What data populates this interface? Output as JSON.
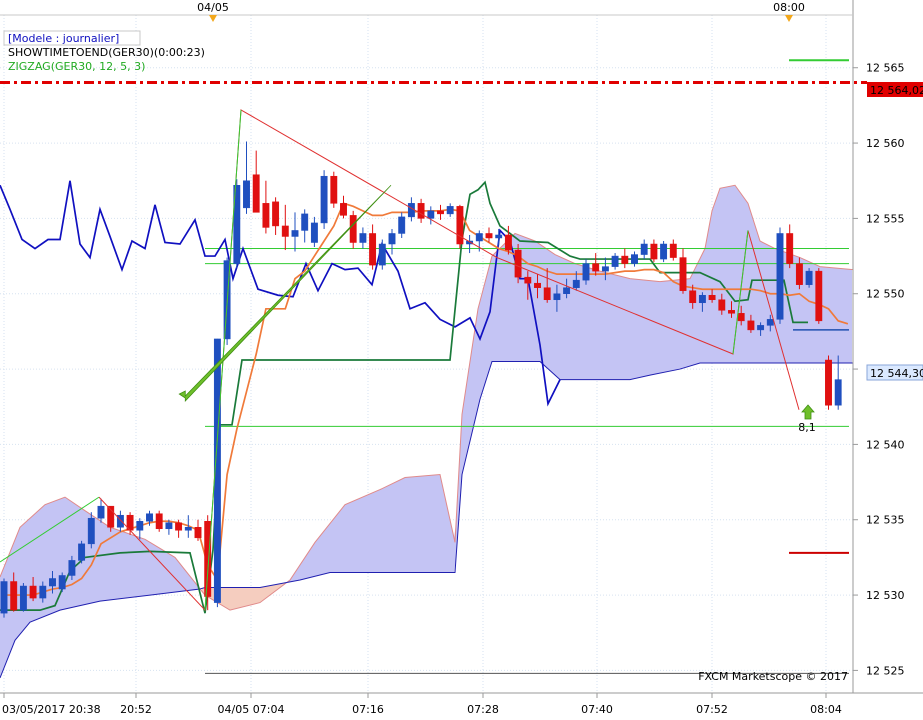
{
  "chart_data": {
    "type": "candlestick",
    "legend": {
      "model": "[Modele : journalier]",
      "indicator1": "SHOWTIMETOEND(GER30)(0:00:23)",
      "indicator2": "ZIGZAG(GER30, 12, 5, 3)"
    },
    "watermark": "FXCM Marketscope © 2017",
    "top_markers": [
      "04/05",
      "08:00"
    ],
    "x_tick_labels": [
      "03/05/2017 20:38",
      "20:52",
      "04/05 07:04",
      "07:16",
      "07:28",
      "07:40",
      "07:52",
      "08:04"
    ],
    "y_tick_labels": [
      "12 525",
      "12 530",
      "12 535",
      "12 540",
      "12 545",
      "12 550",
      "12 555",
      "12 560",
      "12 565"
    ],
    "ylim": [
      12523.5,
      12568.5
    ],
    "price_labels": {
      "red_level": "12 564,02",
      "current": "12 544,30"
    },
    "annotation": "8,1",
    "colors": {
      "bull": "#1f4fbf",
      "bear": "#e01010",
      "cloud_blue": "#c4c4f4",
      "cloud_pink": "#f5cdbf",
      "tenkan": "#f07a3a",
      "kijun": "#1a7a3a",
      "chikou": "#1010c0",
      "zigzag_red": "#e03030",
      "zigzag_green": "#33cc33",
      "level_line": "#33cc33",
      "red_dash": "#e00000"
    },
    "candles": [
      [
        12528.8,
        12531.1,
        12528.5,
        12530.9
      ],
      [
        12530.9,
        12531.5,
        12528.9,
        12529.0
      ],
      [
        12529.0,
        12530.8,
        12528.9,
        12530.6
      ],
      [
        12530.6,
        12531.2,
        12529.6,
        12529.8
      ],
      [
        12529.8,
        12530.9,
        12529.5,
        12530.6
      ],
      [
        12530.6,
        12531.6,
        12530.1,
        12531.1
      ],
      [
        12530.4,
        12531.5,
        12530.2,
        12531.3
      ],
      [
        12531.3,
        12532.6,
        12531.0,
        12532.3
      ],
      [
        12532.3,
        12533.6,
        12532.1,
        12533.4
      ],
      [
        12533.4,
        12535.5,
        12533.1,
        12535.1
      ],
      [
        12535.1,
        12536.4,
        12534.8,
        12535.9
      ],
      [
        12535.9,
        12535.9,
        12534.2,
        12534.5
      ],
      [
        12534.5,
        12535.6,
        12534.2,
        12535.3
      ],
      [
        12535.3,
        12535.5,
        12534.0,
        12534.3
      ],
      [
        12534.3,
        12535.1,
        12533.7,
        12534.9
      ],
      [
        12534.9,
        12535.6,
        12534.6,
        12535.4
      ],
      [
        12535.4,
        12535.6,
        12534.2,
        12534.4
      ],
      [
        12534.4,
        12535.0,
        12534.0,
        12534.8
      ],
      [
        12534.8,
        12535.0,
        12533.8,
        12534.3
      ],
      [
        12534.3,
        12535.3,
        12533.8,
        12534.5
      ],
      [
        12534.5,
        12535.0,
        12533.6,
        12533.8
      ],
      [
        12534.9,
        12535.3,
        12529.0,
        12529.9
      ],
      [
        12529.5,
        12547.0,
        12529.2,
        12547.0
      ],
      [
        12547.0,
        12552.4,
        12546.6,
        12552.2
      ],
      [
        12552.0,
        12557.6,
        12551.7,
        12557.2
      ],
      [
        12555.7,
        12560.1,
        12555.3,
        12557.5
      ],
      [
        12557.9,
        12559.5,
        12555.6,
        12555.4
      ],
      [
        12556.0,
        12557.5,
        12554.0,
        12554.4
      ],
      [
        12556.1,
        12556.4,
        12553.9,
        12554.5
      ],
      [
        12554.5,
        12555.9,
        12552.9,
        12553.8
      ],
      [
        12553.8,
        12555.4,
        12552.8,
        12554.2
      ],
      [
        12554.2,
        12555.6,
        12553.4,
        12555.3
      ],
      [
        12553.4,
        12555.1,
        12553.1,
        12554.7
      ],
      [
        12554.7,
        12558.2,
        12554.3,
        12557.8
      ],
      [
        12557.8,
        12558.1,
        12555.7,
        12556.0
      ],
      [
        12556.0,
        12556.5,
        12555.0,
        12555.2
      ],
      [
        12555.2,
        12555.5,
        12553.0,
        12553.4
      ],
      [
        12553.4,
        12554.4,
        12553.0,
        12554.0
      ],
      [
        12554.0,
        12554.6,
        12551.6,
        12551.9
      ],
      [
        12551.9,
        12553.6,
        12551.6,
        12553.3
      ],
      [
        12553.3,
        12554.3,
        12552.6,
        12554.0
      ],
      [
        12554.0,
        12555.4,
        12553.7,
        12555.1
      ],
      [
        12555.1,
        12556.4,
        12554.8,
        12556.0
      ],
      [
        12556.0,
        12556.3,
        12554.7,
        12555.0
      ],
      [
        12555.0,
        12555.8,
        12554.6,
        12555.5
      ],
      [
        12555.5,
        12555.9,
        12554.9,
        12555.3
      ],
      [
        12555.3,
        12556.0,
        12555.1,
        12555.8
      ],
      [
        12555.8,
        12555.9,
        12553.0,
        12553.3
      ],
      [
        12553.3,
        12553.9,
        12552.7,
        12553.5
      ],
      [
        12553.5,
        12554.2,
        12552.8,
        12554.0
      ],
      [
        12554.0,
        12554.4,
        12553.4,
        12553.7
      ],
      [
        12553.7,
        12554.3,
        12553.2,
        12553.9
      ],
      [
        12553.9,
        12554.5,
        12552.6,
        12552.9
      ],
      [
        12552.9,
        12553.3,
        12550.7,
        12551.1
      ],
      [
        12551.1,
        12551.5,
        12549.6,
        12550.7
      ],
      [
        12550.7,
        12551.3,
        12549.7,
        12550.4
      ],
      [
        12550.4,
        12551.7,
        12549.4,
        12549.6
      ],
      [
        12549.6,
        12550.6,
        12548.8,
        12550.0
      ],
      [
        12550.0,
        12551.0,
        12549.7,
        12550.4
      ],
      [
        12550.4,
        12551.5,
        12550.2,
        12550.9
      ],
      [
        12550.9,
        12552.3,
        12550.6,
        12552.0
      ],
      [
        12552.0,
        12552.7,
        12551.2,
        12551.5
      ],
      [
        12551.5,
        12552.4,
        12550.9,
        12551.8
      ],
      [
        12551.8,
        12552.7,
        12551.6,
        12552.5
      ],
      [
        12552.5,
        12553.0,
        12551.7,
        12552.0
      ],
      [
        12552.0,
        12552.8,
        12551.8,
        12552.6
      ],
      [
        12552.6,
        12553.6,
        12552.3,
        12553.3
      ],
      [
        12553.3,
        12553.6,
        12552.1,
        12552.3
      ],
      [
        12552.3,
        12553.5,
        12552.1,
        12553.3
      ],
      [
        12553.3,
        12553.6,
        12552.2,
        12552.4
      ],
      [
        12552.4,
        12553.0,
        12550.0,
        12550.2
      ],
      [
        12550.2,
        12550.6,
        12549.0,
        12549.4
      ],
      [
        12549.4,
        12550.1,
        12548.8,
        12549.9
      ],
      [
        12549.9,
        12550.3,
        12549.4,
        12549.6
      ],
      [
        12549.6,
        12550.0,
        12548.6,
        12548.9
      ],
      [
        12548.9,
        12549.5,
        12548.4,
        12548.7
      ],
      [
        12548.7,
        12549.2,
        12547.9,
        12548.2
      ],
      [
        12548.2,
        12548.6,
        12547.4,
        12547.6
      ],
      [
        12547.6,
        12548.1,
        12547.2,
        12547.9
      ],
      [
        12547.9,
        12548.6,
        12547.5,
        12548.3
      ],
      [
        12548.3,
        12554.4,
        12548.0,
        12554.0
      ],
      [
        12554.0,
        12554.6,
        12551.7,
        12552.0
      ],
      [
        12552.0,
        12552.4,
        12550.3,
        12550.6
      ],
      [
        12550.6,
        12551.7,
        12550.4,
        12551.5
      ],
      [
        12551.5,
        12551.7,
        12548.0,
        12548.2
      ],
      [
        12545.6,
        12545.9,
        12542.3,
        12542.6
      ],
      [
        12542.6,
        12545.9,
        12542.3,
        12544.3
      ]
    ],
    "tenkan": [
      12530.0,
      12530.0,
      12530.0,
      12530.0,
      12530.2,
      12530.4,
      12530.5,
      12530.7,
      12531.1,
      12532.0,
      12533.4,
      12533.8,
      12534.2,
      12534.4,
      12534.6,
      12534.8,
      12534.9,
      12534.9,
      12534.8,
      12534.6,
      12534.3,
      12532.0,
      12531.0,
      12538.0,
      12541.0,
      12543.5,
      12546.0,
      12549.0,
      12549.0,
      12549.0,
      12551.0,
      12551.5,
      12552.5,
      12553.5,
      12554.5,
      12556.0,
      12555.8,
      12555.5,
      12555.2,
      12555.2,
      12555.4,
      12555.4,
      12555.4,
      12555.5,
      12555.5,
      12555.5,
      12555.6,
      12555.5,
      12554.2,
      12553.8,
      12553.4,
      12553.0,
      12552.8,
      12552.5,
      12552.0,
      12551.8,
      12551.5,
      12551.3,
      12551.3,
      12551.3,
      12551.3,
      12551.3,
      12551.3,
      12551.4,
      12551.5,
      12551.5,
      12551.6,
      12551.6,
      12551.4,
      12550.8,
      12550.5,
      12550.4,
      12550.3,
      12550.3,
      12550.3,
      12550.3,
      12550.3,
      12550.3,
      12550.2,
      12550.0,
      12550.0,
      12549.9,
      12550.0,
      12549.5,
      12549.3,
      12549.0,
      12548.2,
      12548.0
    ]
  }
}
